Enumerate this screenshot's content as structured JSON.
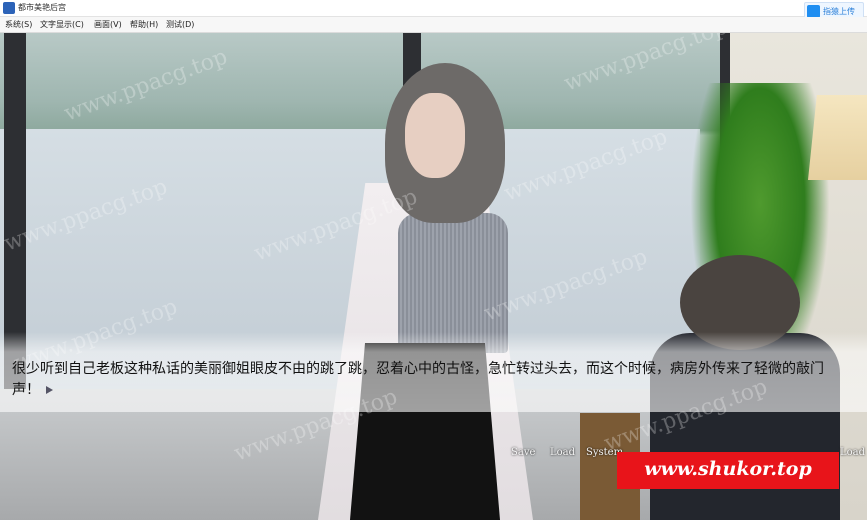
{
  "window": {
    "title": "都市美艳后宫",
    "upload_label": "指猿上传"
  },
  "menu": {
    "items": [
      "系统(S)",
      "文字显示(C)",
      "画面(V)",
      "帮助(H)",
      "测试(D)"
    ]
  },
  "game": {
    "dialog_text": "很少听到自己老板这种私话的美丽御姐眼皮不由的跳了跳，忍着心中的古怪，急忙转过头去，而这个时候，病房外传来了轻微的敲门声！",
    "quick_menu": [
      "Save",
      "Load",
      "System",
      "Load"
    ],
    "watermark": "www.ppacg.top",
    "banner": "www.shukor.top"
  },
  "colors": {
    "banner_bg": "#e8141a",
    "accent": "#1f8ef1"
  }
}
